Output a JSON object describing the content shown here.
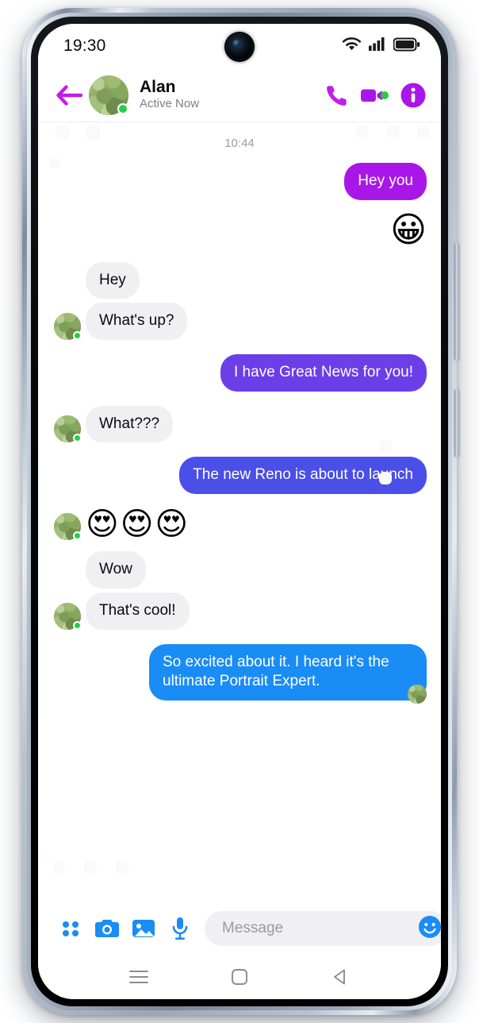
{
  "colors": {
    "accent_purple": "#A916E8",
    "bubble_magenta": "#A916E8",
    "bubble_violet": "#6B3EE8",
    "bubble_indigo": "#4A4FE8",
    "bubble_blue": "#1A8CF5",
    "bubble_incoming": "#F0F0F2",
    "online_green": "#21D04A",
    "messenger_blue": "#1A8CF5"
  },
  "status_bar": {
    "time": "19:30",
    "wifi_icon": "wifi-icon",
    "signal_icon": "signal-bars-icon",
    "battery_icon": "battery-full-icon",
    "camera_icon": "front-camera-punch-hole"
  },
  "chat_header": {
    "back_icon": "back-arrow-icon",
    "contact_name": "Alan",
    "contact_status": "Active Now",
    "avatar_alt": "contact-avatar",
    "call_icon": "phone-call-icon",
    "video_icon": "video-camera-icon",
    "info_icon": "info-circle-icon"
  },
  "conversation": {
    "timestamp": "10:44",
    "messages": [
      {
        "id": 1,
        "side": "out",
        "type": "text",
        "text": "Hey you",
        "color": "#A916E8",
        "avatar": false
      },
      {
        "id": 2,
        "side": "out",
        "type": "emoji",
        "text": "😀",
        "color": "",
        "avatar": false
      },
      {
        "id": 3,
        "side": "in",
        "type": "text",
        "text": "Hey",
        "color": "#F0F0F2",
        "avatar": false
      },
      {
        "id": 4,
        "side": "in",
        "type": "text",
        "text": "What's up?",
        "color": "#F0F0F2",
        "avatar": true
      },
      {
        "id": 5,
        "side": "out",
        "type": "text",
        "text": "I have Great News for you!",
        "color": "#6B3EE8",
        "avatar": false
      },
      {
        "id": 6,
        "side": "in",
        "type": "text",
        "text": "What???",
        "color": "#F0F0F2",
        "avatar": true
      },
      {
        "id": 7,
        "side": "out",
        "type": "text",
        "text": "The new Reno is about to launch",
        "color": "#4A4FE8",
        "avatar": false
      },
      {
        "id": 8,
        "side": "in",
        "type": "emoji",
        "text": "😍😍😍",
        "color": "",
        "avatar": true
      },
      {
        "id": 9,
        "side": "in",
        "type": "text",
        "text": "Wow",
        "color": "#F0F0F2",
        "avatar": false
      },
      {
        "id": 10,
        "side": "in",
        "type": "text",
        "text": "That's cool!",
        "color": "#F0F0F2",
        "avatar": true
      },
      {
        "id": 11,
        "side": "out",
        "type": "text",
        "text": "So excited about it. I heard it's the ultimate Portrait Expert.",
        "color": "#1A8CF5",
        "avatar": false
      }
    ],
    "seen_avatar_alt": "seen-by-avatar"
  },
  "composer": {
    "grid_icon": "app-grid-icon",
    "camera_icon": "camera-icon",
    "gallery_icon": "gallery-image-icon",
    "mic_icon": "microphone-icon",
    "input_value": "",
    "input_placeholder": "Message",
    "emoji_icon": "emoji-smiley-icon",
    "like_icon": "thumbs-up-icon"
  },
  "nav_bar": {
    "recents_icon": "recents-menu-icon",
    "home_icon": "home-square-icon",
    "back_icon": "back-triangle-icon"
  }
}
